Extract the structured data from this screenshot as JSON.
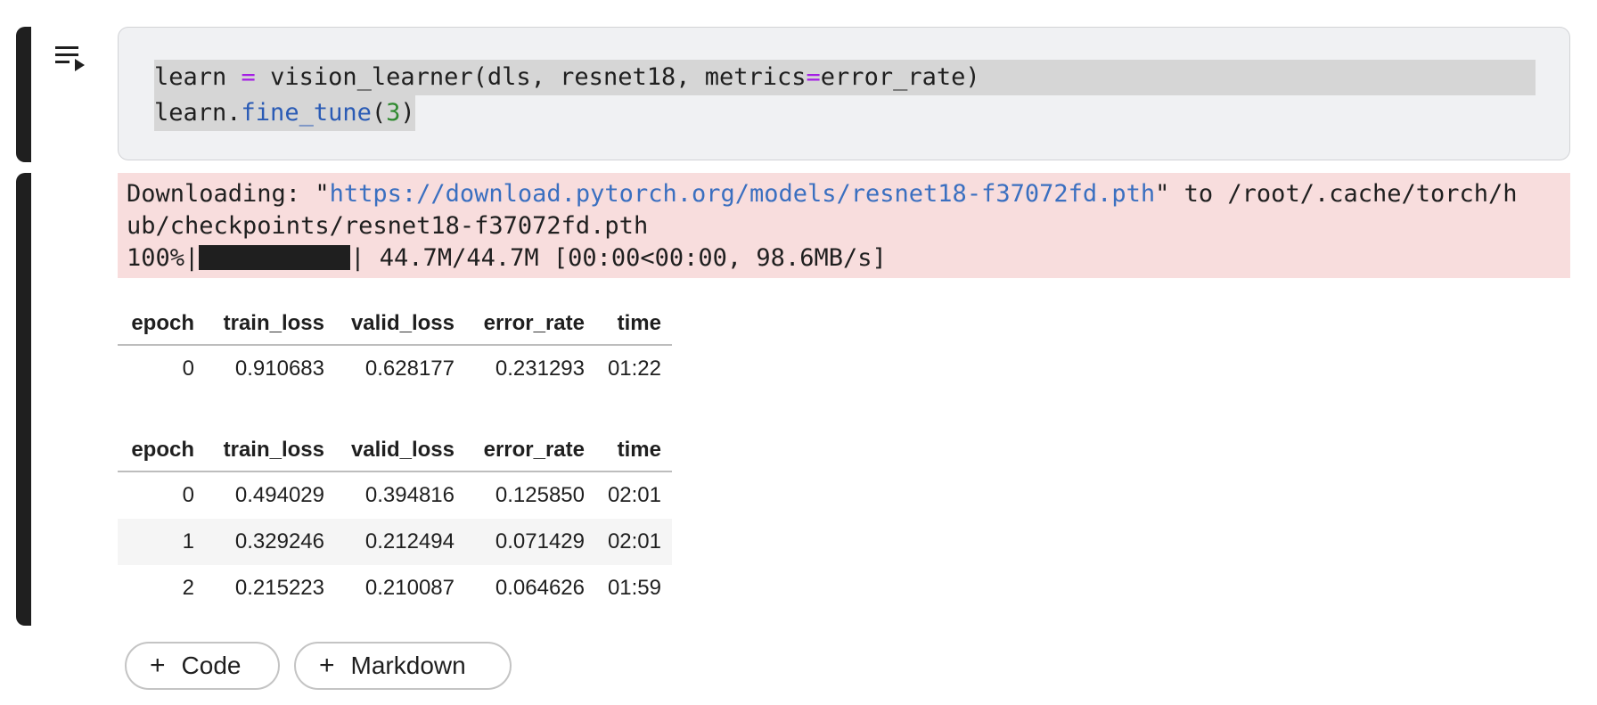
{
  "code_cell": {
    "line1": {
      "t1": "learn ",
      "t2": "=",
      "t3": " vision_learner(dls, resnet18, metrics",
      "t4": "=",
      "t5": "error_rate)"
    },
    "line2": {
      "t1": "learn.",
      "t2": "fine_tune",
      "t3": "(",
      "t4": "3",
      "t5": ")"
    },
    "run_icon": "run-cell-icon"
  },
  "stderr": {
    "line1_prefix": "Downloading: \"",
    "url": "https://download.pytorch.org/models/resnet18-f37072fd.pth",
    "line1_suffix": "\" to /root/.cache/torch/h",
    "line2": "ub/checkpoints/resnet18-f37072fd.pth",
    "progress_percent_text": "100%|",
    "progress_fraction": 1.0,
    "progress_suffix": "| 44.7M/44.7M [00:00<00:00, 98.6MB/s]"
  },
  "tables": [
    {
      "headers": [
        "epoch",
        "train_loss",
        "valid_loss",
        "error_rate",
        "time"
      ],
      "rows": [
        [
          "0",
          "0.910683",
          "0.628177",
          "0.231293",
          "01:22"
        ]
      ]
    },
    {
      "headers": [
        "epoch",
        "train_loss",
        "valid_loss",
        "error_rate",
        "time"
      ],
      "rows": [
        [
          "0",
          "0.494029",
          "0.394816",
          "0.125850",
          "02:01"
        ],
        [
          "1",
          "0.329246",
          "0.212494",
          "0.071429",
          "02:01"
        ],
        [
          "2",
          "0.215223",
          "0.210087",
          "0.064626",
          "01:59"
        ]
      ]
    }
  ],
  "buttons": {
    "add_code_label": "Code",
    "add_markdown_label": "Markdown",
    "plus_glyph": "+"
  },
  "colors": {
    "cell_bar": "#1f1f1f",
    "stderr_bg": "#f8dddd",
    "link": "#3a6fc0",
    "keyword_op": "#a41ee4",
    "function": "#2a5bb5",
    "number": "#318a31"
  }
}
